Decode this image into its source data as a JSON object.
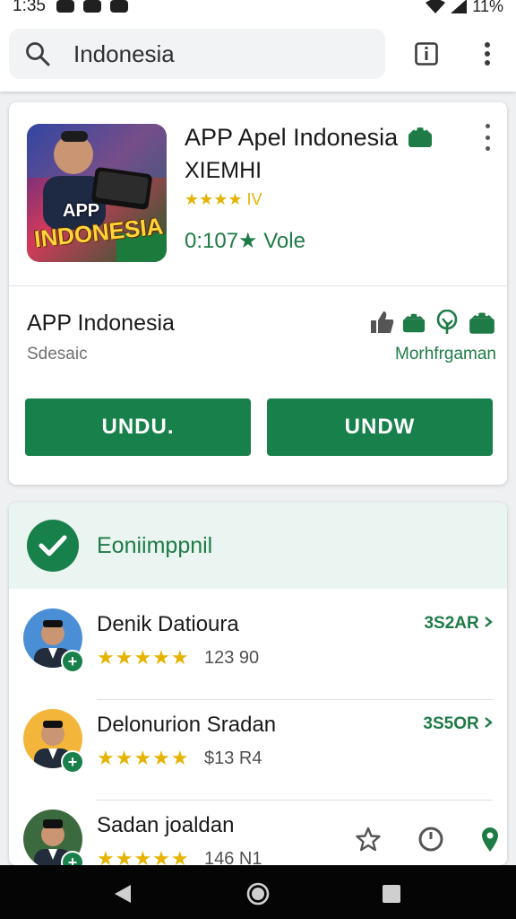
{
  "status_bar": {
    "time": "1:35",
    "battery": "11%"
  },
  "search": {
    "query": "Indonesia"
  },
  "app_card": {
    "title": "APP Apel Indonesia",
    "subtitle": "XIEMHI",
    "rating_text": "★★★★ IV",
    "votes": "0:107★ Vole",
    "icon_text_top": "APP",
    "icon_text_main": "INDONESIA",
    "app_name": "APP Indonesia",
    "developer": "Sdesaic",
    "badge_caption": "Morhfrgaman",
    "button_left": "UNDU.",
    "button_right": "UNDW"
  },
  "list_card": {
    "header": "Eoniimppnil",
    "items": [
      {
        "name": "Denik Datioura",
        "stars": "★★★★★",
        "count": "123 90",
        "price": "3S2AR",
        "avatar_bg": "#4a8fd6"
      },
      {
        "name": "Delonurion Sradan",
        "stars": "★★★★★",
        "count": "$13 R4",
        "price": "3S5OR",
        "avatar_bg": "#f3b63a"
      },
      {
        "name": "Sadan joaldan",
        "stars": "★★★★★",
        "count": "146 N1",
        "price": "",
        "avatar_bg": "#3c6a3f"
      }
    ]
  },
  "colors": {
    "accent": "#18804a",
    "star": "#e6b400",
    "header_bg": "#eaf4f0"
  },
  "icons": [
    "search-icon",
    "info-icon",
    "more-vert-icon",
    "android-icon",
    "thumbs-up-icon",
    "check-icon",
    "star-outline-icon",
    "timer-icon",
    "location-icon",
    "back-icon",
    "home-icon",
    "recents-icon"
  ]
}
